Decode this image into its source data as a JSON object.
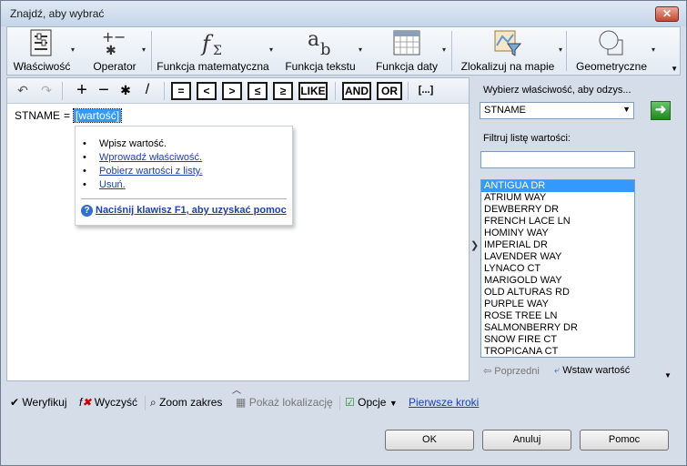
{
  "window": {
    "title": "Znajdź, aby wybrać",
    "close_label": "✕"
  },
  "ribbon": {
    "groups": [
      {
        "label": "Właściwość",
        "icon": "property-list-icon"
      },
      {
        "label": "Operator",
        "icon": "operator-icon"
      },
      {
        "label": "Funkcja matematyczna",
        "icon": "math-function-icon"
      },
      {
        "label": "Funkcja tekstu",
        "icon": "text-function-icon"
      },
      {
        "label": "Funkcja daty",
        "icon": "calendar-icon"
      },
      {
        "label": "Zlokalizuj na mapie",
        "icon": "map-filter-icon"
      },
      {
        "label": "Geometryczne",
        "icon": "geometry-shapes-icon"
      }
    ]
  },
  "toolbar": {
    "undo": "↶",
    "redo": "↷",
    "plus": "+",
    "minus": "−",
    "asterisk": "✱",
    "slash": "/",
    "eq": "=",
    "lt": "<",
    "gt": ">",
    "le": "≤",
    "ge": "≥",
    "like": "LIKE",
    "and": "AND",
    "or": "OR",
    "list": "[...]"
  },
  "expression": {
    "field": "STNAME",
    "operator": "=",
    "value": "[wartość]"
  },
  "popup": {
    "items": [
      {
        "text": "Wpisz wartość.",
        "link": false
      },
      {
        "text": "Wprowadź właściwość.",
        "link": true
      },
      {
        "text": "Pobierz wartości z listy.",
        "link": true
      },
      {
        "text": "Usuń.",
        "link": true
      }
    ],
    "help": "Naciśnij klawisz F1, aby uzyskać pomoc"
  },
  "right_panel": {
    "select_label": "Wybierz właściwość, aby odzys...",
    "property_value": "STNAME",
    "filter_label": "Filtruj listę wartości:",
    "filter_value": "",
    "values": [
      "ANTIGUA DR",
      "ATRIUM WAY",
      "DEWBERRY DR",
      "FRENCH LACE LN",
      "HOMINY WAY",
      "IMPERIAL DR",
      "LAVENDER WAY",
      "LYNACO CT",
      "MARIGOLD WAY",
      "OLD ALTURAS RD",
      "PURPLE WAY",
      "ROSE TREE LN",
      "SALMONBERRY DR",
      "SNOW FIRE CT",
      "TROPICANA CT"
    ],
    "selected_index": 0,
    "prev_label": "Poprzedni",
    "insert_label": "Wstaw wartość"
  },
  "bottom_bar": {
    "verify": "Weryfikuj",
    "clear": "Wyczyść",
    "zoom": "Zoom zakres",
    "show_locations": "Pokaż lokalizację",
    "options": "Opcje",
    "getting_started": "Pierwsze kroki"
  },
  "buttons": {
    "ok": "OK",
    "cancel": "Anuluj",
    "help": "Pomoc"
  }
}
